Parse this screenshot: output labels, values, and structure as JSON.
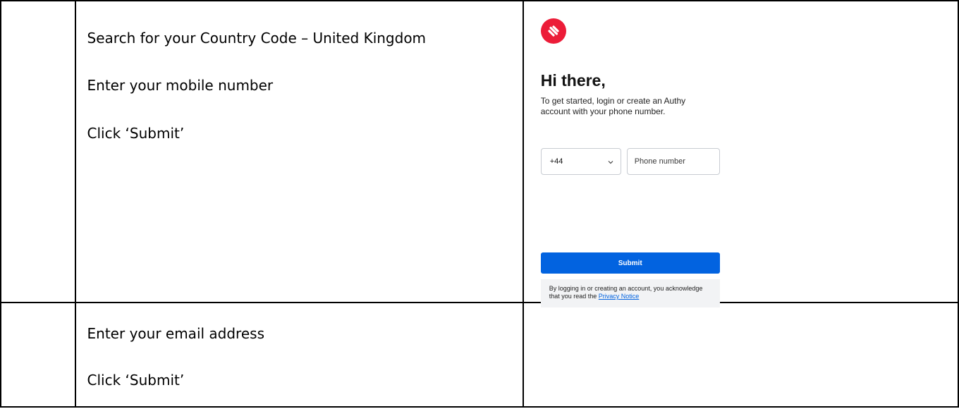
{
  "steps": [
    {
      "instructions": [
        "Search for your Country Code – United Kingdom",
        "Enter your mobile number",
        "Click ‘Submit’"
      ],
      "screenshot": {
        "logo": "authy-logo-icon",
        "heading": "Hi there,",
        "subtitle": "To get started, login or create an Authy account with your phone number.",
        "country_code": "+44",
        "phone_placeholder": "Phone number",
        "submit_label": "Submit",
        "notice_text": "By logging in or creating an account, you acknowledge that you read the",
        "notice_link": "Privacy Notice"
      }
    },
    {
      "instructions": [
        "Enter your email address",
        "Click ‘Submit’"
      ]
    }
  ],
  "colors": {
    "brand_red": "#ec1c38",
    "primary_blue": "#0263e0",
    "notice_bg": "#f2f3f5"
  }
}
